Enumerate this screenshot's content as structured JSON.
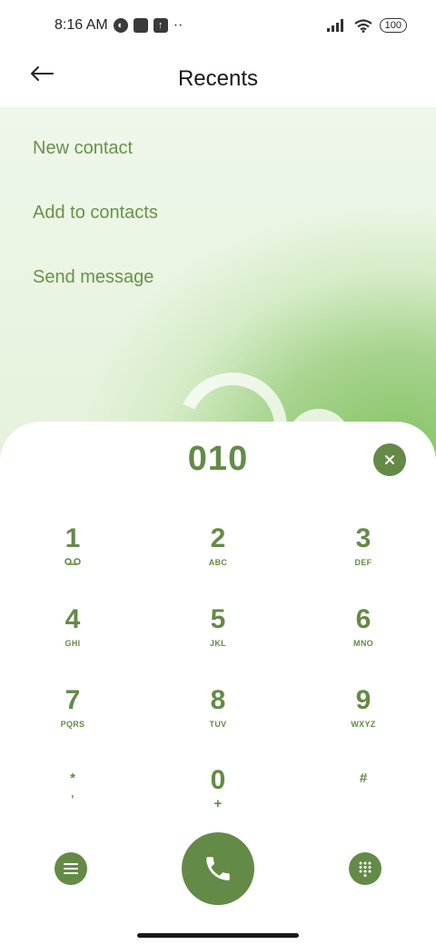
{
  "status_bar": {
    "time": "8:16 AM",
    "battery": "100",
    "more": "··"
  },
  "header": {
    "title": "Recents"
  },
  "menu": {
    "items": [
      {
        "label": "New contact"
      },
      {
        "label": "Add to contacts"
      },
      {
        "label": "Send message"
      }
    ]
  },
  "dialpad": {
    "number": "010",
    "keys": [
      {
        "digit": "1",
        "letters": ""
      },
      {
        "digit": "2",
        "letters": "ABC"
      },
      {
        "digit": "3",
        "letters": "DEF"
      },
      {
        "digit": "4",
        "letters": "GHI"
      },
      {
        "digit": "5",
        "letters": "JKL"
      },
      {
        "digit": "6",
        "letters": "MNO"
      },
      {
        "digit": "7",
        "letters": "PQRS"
      },
      {
        "digit": "8",
        "letters": "TUV"
      },
      {
        "digit": "9",
        "letters": "WXYZ"
      },
      {
        "digit": "*",
        "letters": ","
      },
      {
        "digit": "0",
        "letters": "+"
      },
      {
        "digit": "#",
        "letters": ""
      }
    ]
  },
  "colors": {
    "accent": "#648a47",
    "menu_text": "#6a914b"
  },
  "icons": {
    "back": "arrow-left-icon",
    "clear": "close-icon",
    "voicemail": "voicemail-icon",
    "menu": "menu-icon",
    "call": "phone-icon",
    "keypad": "dialpad-icon"
  }
}
